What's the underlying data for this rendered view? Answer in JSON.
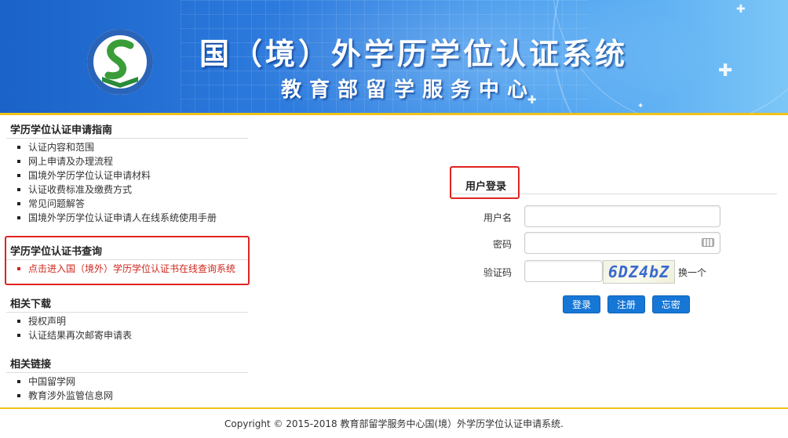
{
  "header": {
    "title": "国（境）外学历学位认证系统",
    "subtitle": "教育部留学服务中心"
  },
  "sidebar": {
    "sections": [
      {
        "heading": "学历学位认证申请指南",
        "items": [
          "认证内容和范围",
          "网上申请及办理流程",
          "国境外学历学位认证申请材料",
          "认证收费标准及缴费方式",
          "常见问题解答",
          "国境外学历学位认证申请人在线系统使用手册"
        ]
      },
      {
        "heading": "学历学位认证书查询",
        "items": [
          "点击进入国（境外）学历学位认证书在线查询系统"
        ]
      },
      {
        "heading": "相关下载",
        "items": [
          "授权声明",
          "认证结果再次邮寄申请表"
        ]
      },
      {
        "heading": "相关链接",
        "items": [
          "中国留学网",
          "教育涉外监管信息网"
        ]
      }
    ]
  },
  "login": {
    "title": "用户登录",
    "username_label": "用户名",
    "username_value": "",
    "password_label": "密码",
    "password_value": "",
    "captcha_label": "验证码",
    "captcha_value": "",
    "captcha_text": "6DZ4bZ",
    "captcha_change": "换一个",
    "login_button": "登录",
    "register_button": "注册",
    "forgot_button": "忘密"
  },
  "footer": {
    "copyright": "Copyright © 2015-2018 教育部留学服务中心国(境）外学历学位认证申请系统."
  },
  "colors": {
    "accent_blue": "#1677d6",
    "highlight_red": "#e02420",
    "banner_stripe": "#f1c21a"
  }
}
